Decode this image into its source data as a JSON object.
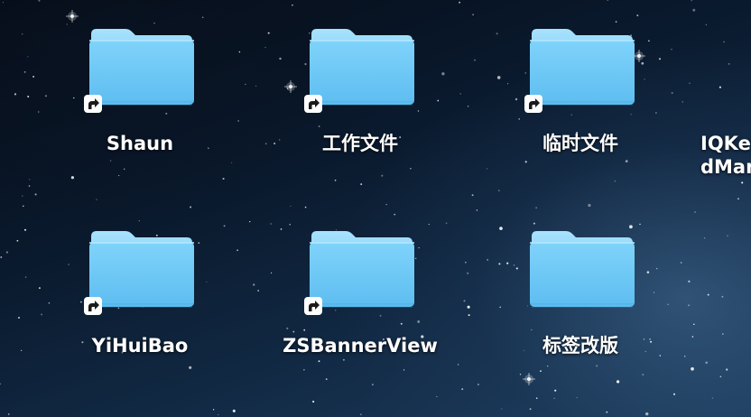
{
  "desktop": {
    "items": [
      {
        "label": "Shaun",
        "alias": true
      },
      {
        "label": "工作文件",
        "alias": true
      },
      {
        "label": "临时文件",
        "alias": true
      },
      {
        "label": "IQKeyboardManager",
        "alias": false
      },
      {
        "label": "YiHuiBao",
        "alias": true
      },
      {
        "label": "ZSBannerView",
        "alias": true
      },
      {
        "label": "标签改版",
        "alias": false
      }
    ]
  },
  "colors": {
    "folder_front": "#6cc9f5",
    "folder_back": "#9adcfb",
    "label_text": "#ffffff"
  }
}
